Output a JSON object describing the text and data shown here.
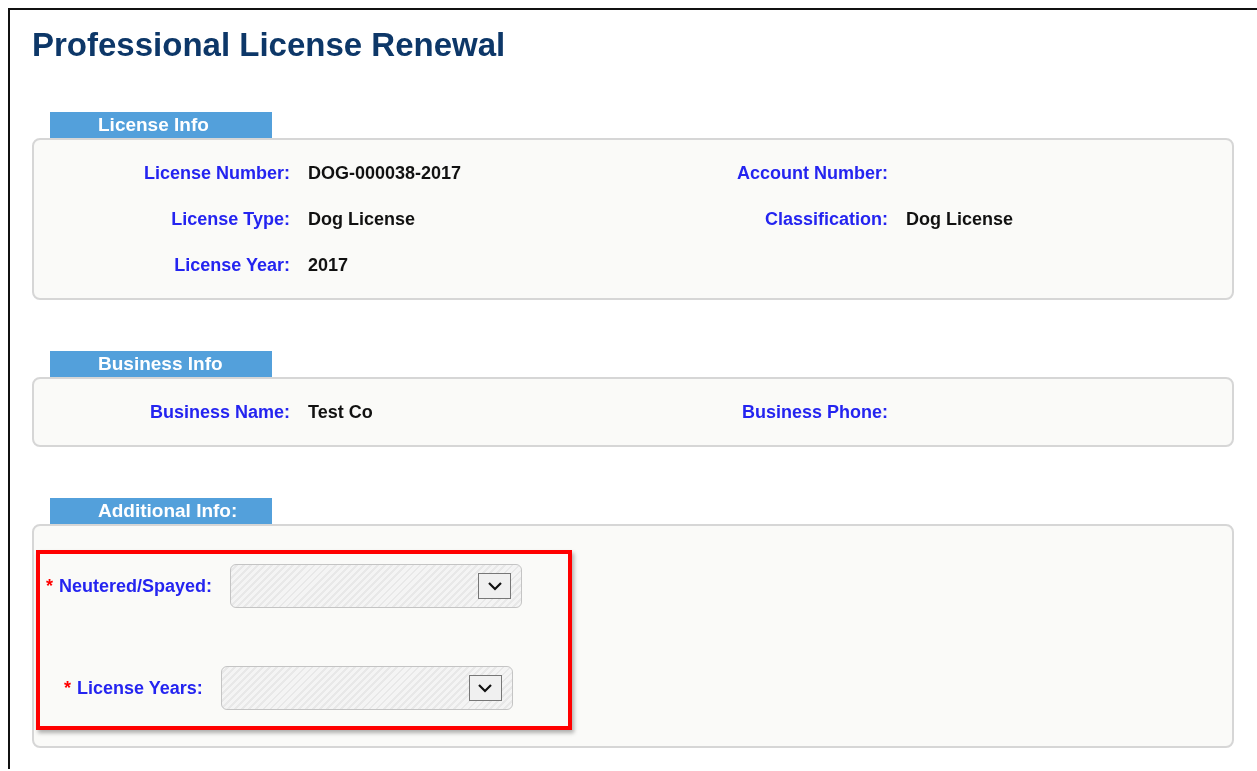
{
  "title": "Professional License Renewal",
  "sections": [
    {
      "heading": "License Info",
      "fields": [
        {
          "kind": "text",
          "label": "License Number:",
          "value": "DOG-000038-2017"
        },
        {
          "kind": "text",
          "label": "Account Number:"
        },
        {
          "kind": "text",
          "label": "License Type:",
          "value": "Dog License"
        },
        {
          "kind": "text",
          "label": "Classification:",
          "value": "Dog License"
        },
        {
          "kind": "text",
          "label": "License Year:",
          "value": "2017"
        }
      ]
    },
    {
      "heading": "Business Info",
      "fields": [
        {
          "kind": "text",
          "label": "Business Name:",
          "value": "Test Co"
        },
        {
          "kind": "text",
          "label": "Business Phone:"
        }
      ]
    },
    {
      "heading": "Additional Info:",
      "highlighted": true,
      "fields": [
        {
          "kind": "select",
          "label": "Neutered/Spayed:",
          "required_mark": "*"
        },
        {
          "kind": "select",
          "label": "License Years:",
          "required_mark": "*"
        }
      ]
    }
  ]
}
